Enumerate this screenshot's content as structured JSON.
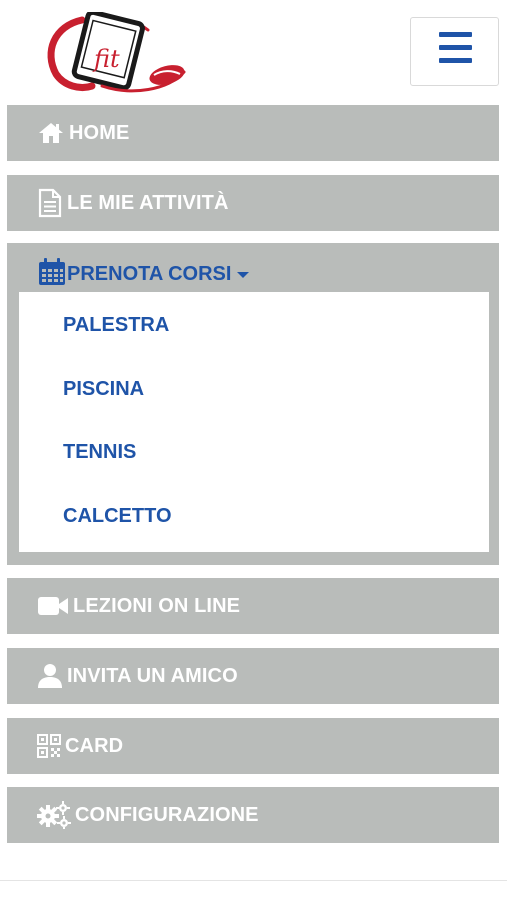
{
  "header": {
    "logo_text": "fit",
    "menu_icon": "hamburger-icon"
  },
  "menu": {
    "home": {
      "label": "HOME",
      "icon": "home-icon"
    },
    "activities": {
      "label": "LE MIE ATTIVITÀ",
      "icon": "document-icon"
    },
    "book": {
      "label": "PRENOTA CORSI",
      "icon": "calendar-icon",
      "items": [
        "PALESTRA",
        "PISCINA",
        "TENNIS",
        "CALCETTO"
      ]
    },
    "lessons": {
      "label": "LEZIONI ON LINE",
      "icon": "video-camera-icon"
    },
    "invite": {
      "label": "INVITA UN AMICO",
      "icon": "user-icon"
    },
    "card": {
      "label": "CARD",
      "icon": "qr-code-icon"
    },
    "config": {
      "label": "CONFIGURAZIONE",
      "icon": "gears-icon"
    }
  },
  "colors": {
    "accent": "#1f54a8",
    "menu_bg": "#b9bcba",
    "logo_red": "#c8202f"
  }
}
